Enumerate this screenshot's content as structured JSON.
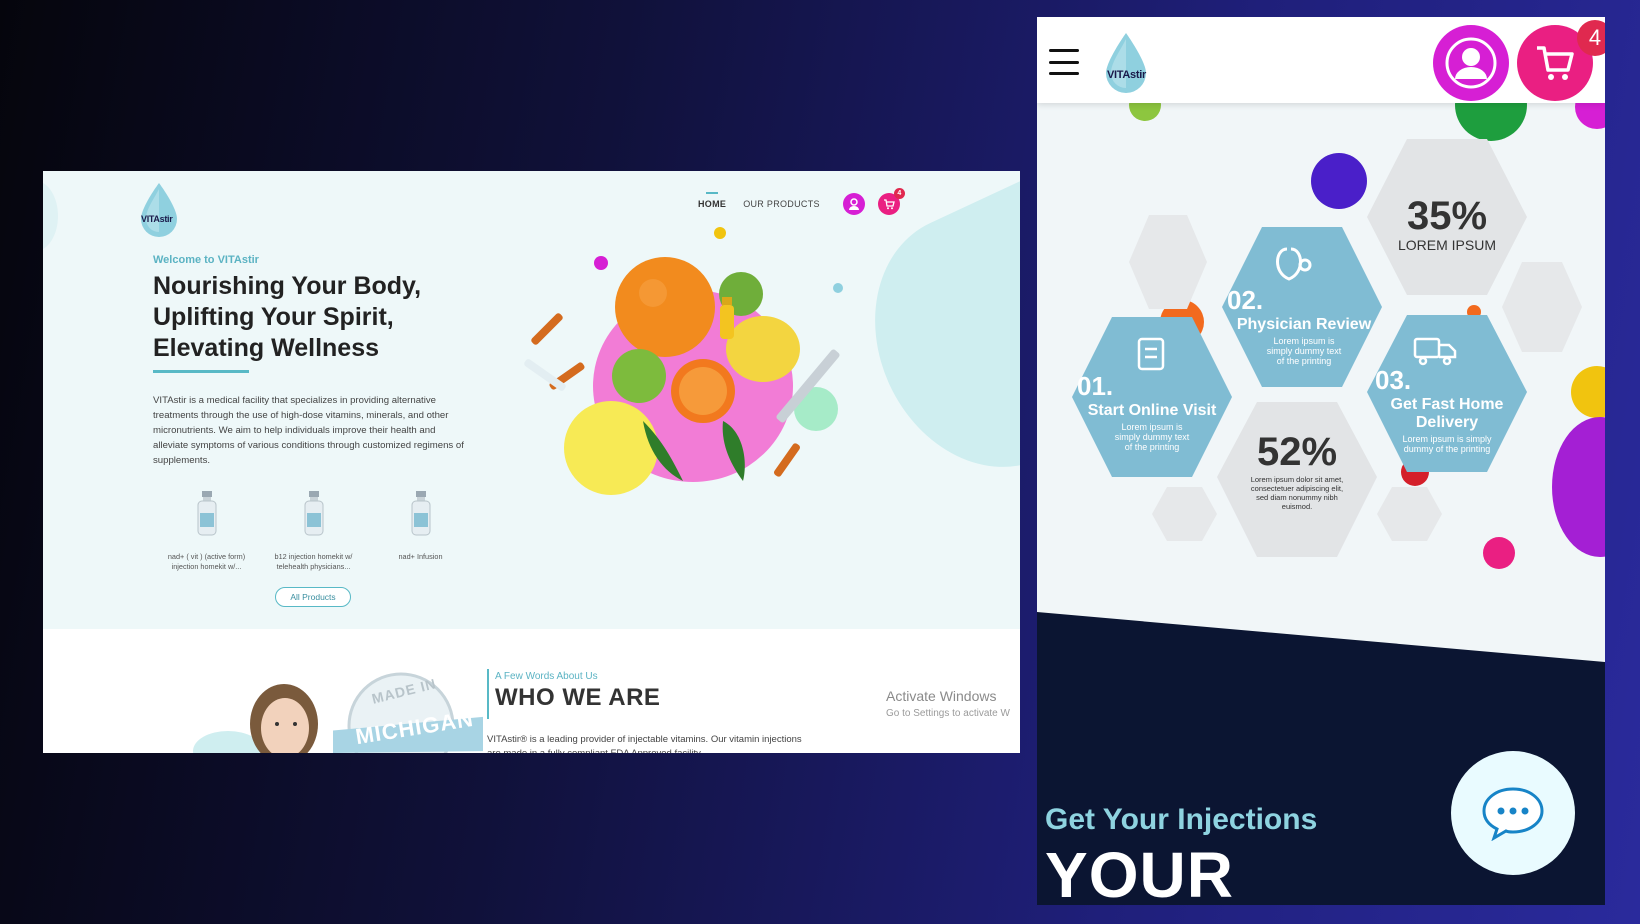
{
  "desktop": {
    "logo_text": "VITAstir",
    "nav": {
      "home": "HOME",
      "products": "OUR PRODUCTS",
      "cart_count": "4"
    },
    "hero": {
      "welcome": "Welcome to VITAstir",
      "title": "Nourishing Your Body, Uplifting Your Spirit, Elevating Wellness",
      "description": "VITAstir is a medical facility that specializes in providing alternative treatments through the use of high-dose vitamins, minerals, and other micronutrients. We aim to help individuals improve their health and alleviate symptoms of various conditions through customized regimens of supplements."
    },
    "products": [
      {
        "name": "nad+ ( vit ) (active form) injection homekit w/..."
      },
      {
        "name": "b12 injection homekit w/ telehealth physicians..."
      },
      {
        "name": "nad+ Infusion"
      }
    ],
    "all_products": "All Products",
    "about": {
      "label": "A Few Words About Us",
      "title": "WHO WE ARE",
      "description": "VITAstir® is a leading provider of injectable vitamins. Our vitamin injections are made in a fully compliant FDA Approved facility."
    },
    "stamp": {
      "top": "MADE IN",
      "main": "MICHIGAN"
    },
    "windows": {
      "line1": "Activate Windows",
      "line2": "Go to Settings to activate W"
    }
  },
  "mobile": {
    "logo_text": "VITAstir",
    "cart_count": "4",
    "steps": [
      {
        "num": "01.",
        "title": "Start Online Visit",
        "desc": "Lorem ipsum is simply dummy text of the printing"
      },
      {
        "num": "02.",
        "title": "Physician Review",
        "desc": "Lorem ipsum is simply dummy text of the printing"
      },
      {
        "num": "03.",
        "title": "Get Fast Home Delivery",
        "desc": "Lorem ipsum is simply dummy of the printing"
      }
    ],
    "stats": [
      {
        "value": "35%",
        "label": "LOREM IPSUM"
      },
      {
        "value": "52%",
        "label": "Lorem ipsum dolor sit amet, consectetuer adipiscing elit, sed diam nonummy nibh euismod."
      }
    ],
    "cta_line": "Get Your Injections",
    "cta_big": "YOUR"
  },
  "colors": {
    "accent": "#58b9c6",
    "pink": "#ea1f82",
    "magenta": "#d61fd4",
    "dark": "#0b1532"
  }
}
